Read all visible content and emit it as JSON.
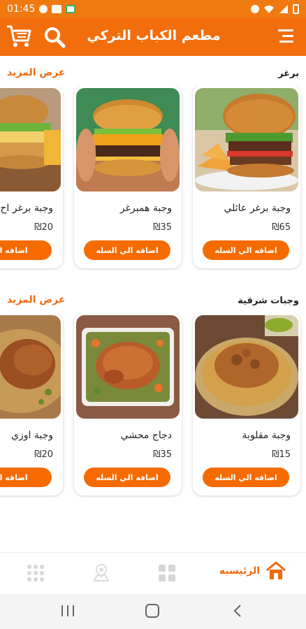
{
  "status_bar": {
    "time": "01:45"
  },
  "app_bar": {
    "title": "مطعم الكباب التركي"
  },
  "sections": [
    {
      "name": "برغر",
      "more_label": "عرض المزيد",
      "products": [
        {
          "name": "وجبة برغر عائلي",
          "price": "₪65",
          "add_label": "اضافه الي السله"
        },
        {
          "name": "وجبة همبرغر",
          "price": "₪35",
          "add_label": "اضافه الي السله"
        },
        {
          "name": "وجبة برغر اح",
          "price": "₪20",
          "add_label": "اضافه الي"
        }
      ]
    },
    {
      "name": "وجبات شرقية",
      "more_label": "عرض المزيد",
      "products": [
        {
          "name": "وجبة مقلوبة",
          "price": "₪15",
          "add_label": "اضافه الي السله"
        },
        {
          "name": "دجاج محشي",
          "price": "₪35",
          "add_label": "اضافه الي السله"
        },
        {
          "name": "وجبة اوزي",
          "price": "₪20",
          "add_label": "اضافه الي"
        }
      ]
    }
  ],
  "bottom_nav": {
    "home_label": "الرئيسيه"
  },
  "colors": {
    "primary": "#f26e0d",
    "button": "#f56b00",
    "accent_text": "#ee6a0f"
  }
}
